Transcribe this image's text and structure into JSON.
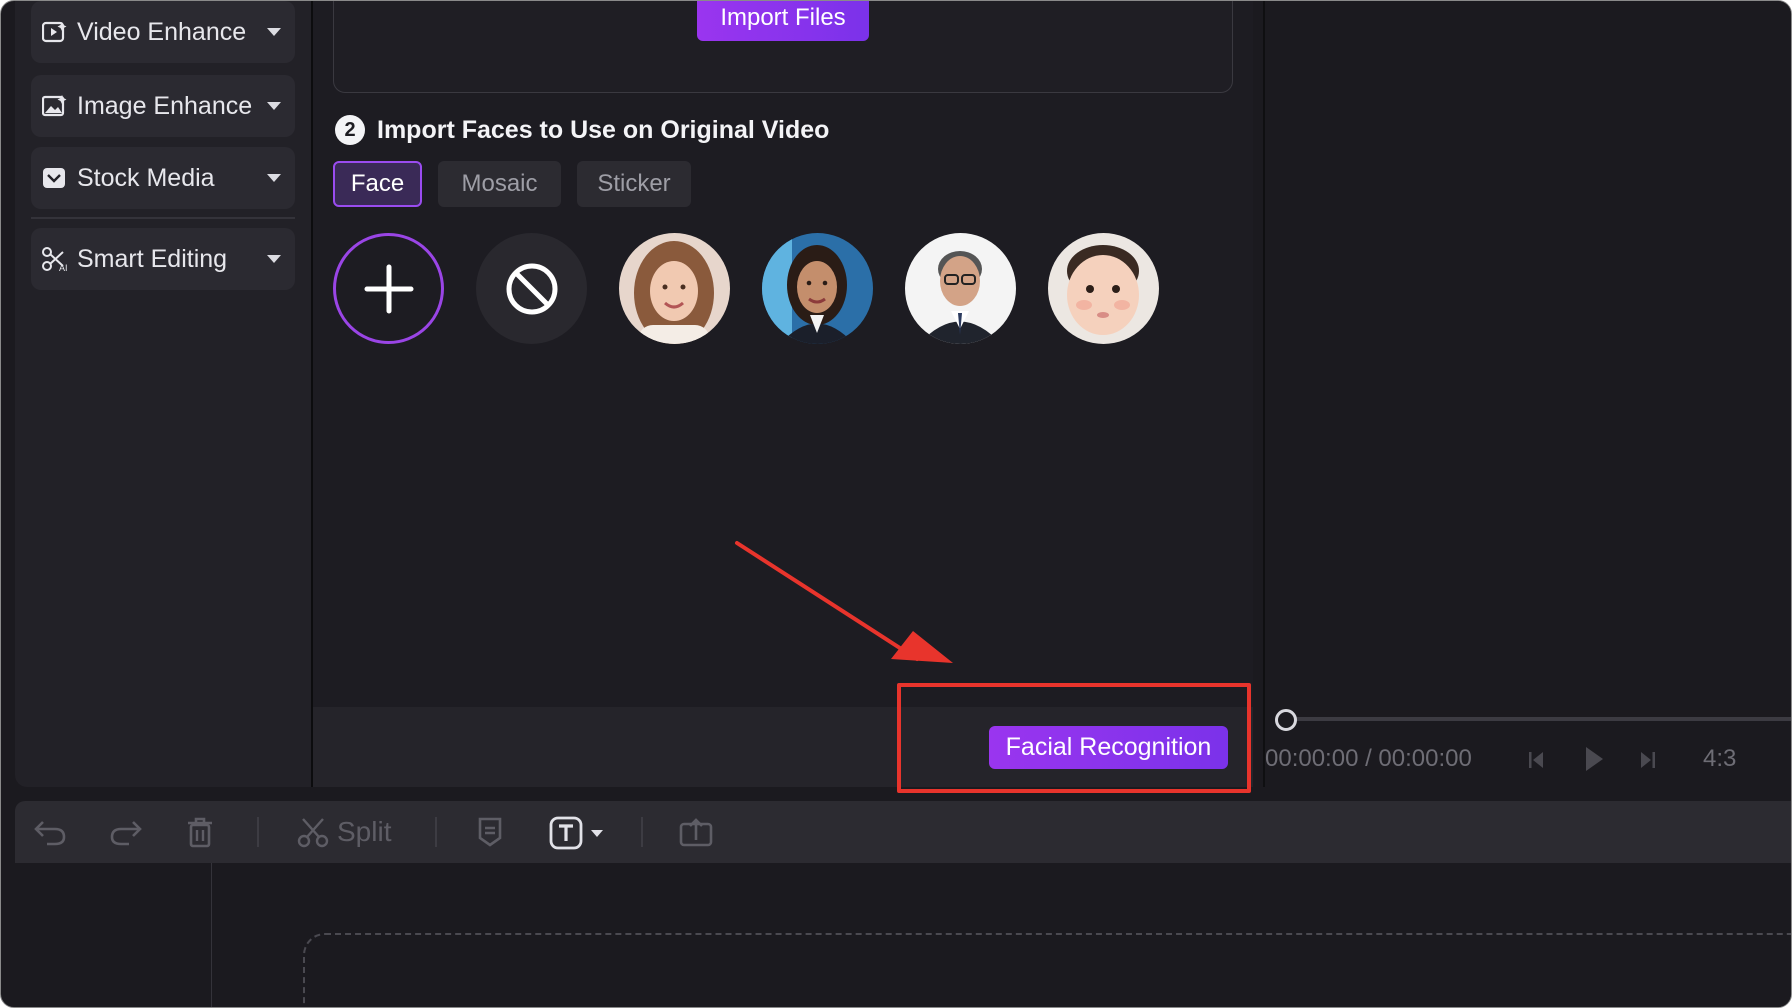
{
  "sidebar": {
    "items": [
      {
        "label": "Video Enhance",
        "icon": "video-enhance-icon"
      },
      {
        "label": "Image Enhance",
        "icon": "image-enhance-icon"
      },
      {
        "label": "Stock Media",
        "icon": "stock-media-icon"
      },
      {
        "label": "Smart Editing",
        "icon": "smart-editing-icon"
      }
    ]
  },
  "panel": {
    "import_button": "Import Files",
    "step_number": "2",
    "section_title": "Import Faces to Use on Original Video",
    "tabs": [
      {
        "label": "Face",
        "active": true
      },
      {
        "label": "Mosaic",
        "active": false
      },
      {
        "label": "Sticker",
        "active": false
      }
    ],
    "faces": [
      {
        "kind": "add",
        "icon": "plus-icon"
      },
      {
        "kind": "none",
        "icon": "no-symbol-icon"
      },
      {
        "kind": "photo",
        "subject": "young woman smiling"
      },
      {
        "kind": "photo",
        "subject": "businesswoman"
      },
      {
        "kind": "photo",
        "subject": "businessman with glasses"
      },
      {
        "kind": "photo",
        "subject": "baby"
      }
    ],
    "action_button": "Facial Recognition"
  },
  "preview": {
    "timecode": "00:00:00 / 00:00:00",
    "aspect_ratio": "4:3"
  },
  "toolbar": {
    "split_label": "Split",
    "icons": [
      "undo-icon",
      "redo-icon",
      "delete-icon",
      "scissors-icon",
      "marker-icon",
      "text-icon",
      "export-icon"
    ]
  },
  "colors": {
    "accent": "#8b35ec",
    "highlight": "#e8342c",
    "background": "#1d1c22"
  }
}
